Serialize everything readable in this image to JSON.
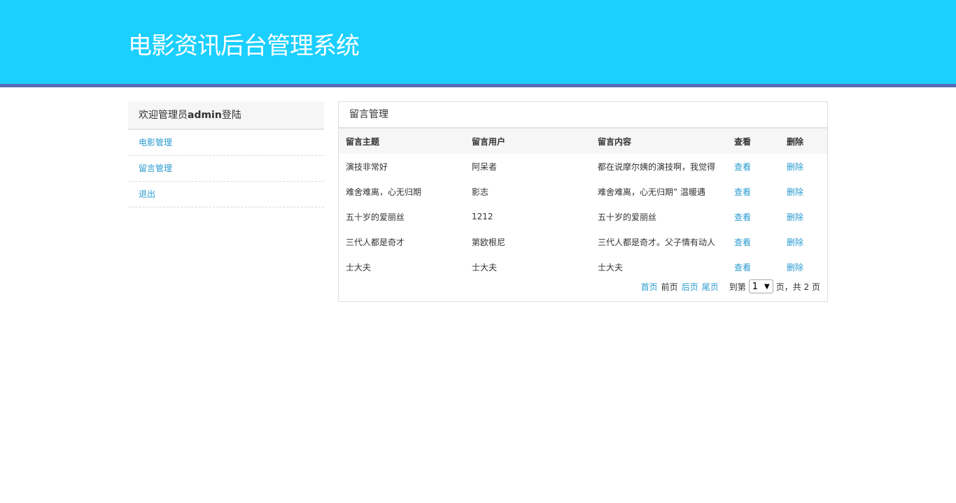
{
  "header": {
    "title": "电影资讯后台管理系统"
  },
  "sidebar": {
    "welcome_prefix": "欢迎管理员",
    "welcome_user": "admin",
    "welcome_suffix": "登陆",
    "items": [
      {
        "label": "电影管理"
      },
      {
        "label": "留言管理"
      },
      {
        "label": "退出"
      }
    ]
  },
  "panel": {
    "title": "留言管理",
    "columns": [
      "留言主题",
      "留言用户",
      "留言内容",
      "查看",
      "删除"
    ],
    "rows": [
      {
        "subject": "演技非常好",
        "user": "阿呆者",
        "content": "都在说摩尔姨的演技啊，我觉得",
        "view": "查看",
        "delete": "删除"
      },
      {
        "subject": "难舍难离，心无归期",
        "user": "影志",
        "content": "难舍难离，心无归期”  温暖遇",
        "view": "查看",
        "delete": "删除"
      },
      {
        "subject": "五十岁的爱丽丝",
        "user": "1212",
        "content": "五十岁的爱丽丝",
        "view": "查看",
        "delete": "删除"
      },
      {
        "subject": "三代人都是奇才",
        "user": "第欧根尼",
        "content": "三代人都是奇才。父子情有动人",
        "view": "查看",
        "delete": "删除"
      },
      {
        "subject": "士大夫",
        "user": "士大夫",
        "content": "士大夫",
        "view": "查看",
        "delete": "删除"
      }
    ]
  },
  "pager": {
    "first": "首页",
    "prev": "前页",
    "next": "后页",
    "last": "尾页",
    "goto_prefix": "到第",
    "current_page": "1",
    "goto_suffix": "页，共 2 页"
  }
}
